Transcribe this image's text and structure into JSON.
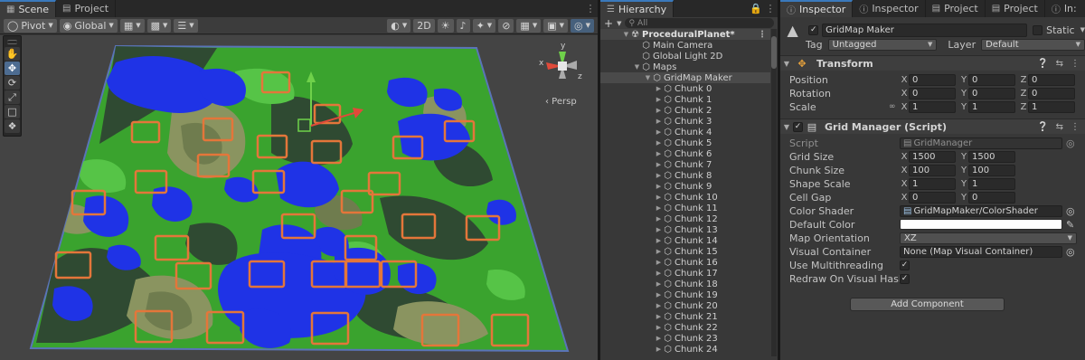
{
  "scene_panel": {
    "tabs": [
      {
        "label": "Scene",
        "icon": "grid-icon",
        "active": true
      },
      {
        "label": "Project",
        "icon": "folder-icon",
        "active": false
      }
    ],
    "toolbar": {
      "pivot_label": "Pivot",
      "global_label": "Global",
      "mode_2d_label": "2D"
    },
    "persp_label": "‹ Persp",
    "gizmo_axes": {
      "x": "x",
      "y": "y",
      "z": "z"
    },
    "colors": {
      "land_light": "#3aa32e",
      "land_dark": "#2f4a32",
      "land_sand": "#8a9460",
      "water": "#1f33e6",
      "chunk_outline": "#e4763a",
      "grid_border": "#5a74b8"
    }
  },
  "hierarchy": {
    "tab_label": "Hierarchy",
    "search_placeholder": "All",
    "scene_name": "ProceduralPlanet*",
    "items": [
      {
        "label": "Main Camera",
        "depth": 1,
        "fold": ""
      },
      {
        "label": "Global Light 2D",
        "depth": 1,
        "fold": ""
      },
      {
        "label": "Maps",
        "depth": 1,
        "fold": "▼"
      },
      {
        "label": "GridMap Maker",
        "depth": 2,
        "fold": "▼",
        "selected": true
      },
      {
        "label": "Chunk 0",
        "depth": 3,
        "fold": "▶"
      },
      {
        "label": "Chunk 1",
        "depth": 3,
        "fold": "▶"
      },
      {
        "label": "Chunk 2",
        "depth": 3,
        "fold": "▶"
      },
      {
        "label": "Chunk 3",
        "depth": 3,
        "fold": "▶"
      },
      {
        "label": "Chunk 4",
        "depth": 3,
        "fold": "▶"
      },
      {
        "label": "Chunk 5",
        "depth": 3,
        "fold": "▶"
      },
      {
        "label": "Chunk 6",
        "depth": 3,
        "fold": "▶"
      },
      {
        "label": "Chunk 7",
        "depth": 3,
        "fold": "▶"
      },
      {
        "label": "Chunk 8",
        "depth": 3,
        "fold": "▶"
      },
      {
        "label": "Chunk 9",
        "depth": 3,
        "fold": "▶"
      },
      {
        "label": "Chunk 10",
        "depth": 3,
        "fold": "▶"
      },
      {
        "label": "Chunk 11",
        "depth": 3,
        "fold": "▶"
      },
      {
        "label": "Chunk 12",
        "depth": 3,
        "fold": "▶"
      },
      {
        "label": "Chunk 13",
        "depth": 3,
        "fold": "▶"
      },
      {
        "label": "Chunk 14",
        "depth": 3,
        "fold": "▶"
      },
      {
        "label": "Chunk 15",
        "depth": 3,
        "fold": "▶"
      },
      {
        "label": "Chunk 16",
        "depth": 3,
        "fold": "▶"
      },
      {
        "label": "Chunk 17",
        "depth": 3,
        "fold": "▶"
      },
      {
        "label": "Chunk 18",
        "depth": 3,
        "fold": "▶"
      },
      {
        "label": "Chunk 19",
        "depth": 3,
        "fold": "▶"
      },
      {
        "label": "Chunk 20",
        "depth": 3,
        "fold": "▶"
      },
      {
        "label": "Chunk 21",
        "depth": 3,
        "fold": "▶"
      },
      {
        "label": "Chunk 22",
        "depth": 3,
        "fold": "▶"
      },
      {
        "label": "Chunk 23",
        "depth": 3,
        "fold": "▶"
      },
      {
        "label": "Chunk 24",
        "depth": 3,
        "fold": "▶"
      }
    ]
  },
  "inspector": {
    "tabs": [
      {
        "label": "Inspector",
        "icon": "info-icon",
        "active": true
      },
      {
        "label": "Inspector",
        "icon": "info-icon",
        "active": false
      },
      {
        "label": "Project",
        "icon": "folder-icon",
        "active": false
      },
      {
        "label": "Project",
        "icon": "folder-icon",
        "active": false
      },
      {
        "label": "In:",
        "icon": "info-icon",
        "active": false
      }
    ],
    "object": {
      "name": "GridMap Maker",
      "static_label": "Static",
      "tag_label": "Tag",
      "tag_value": "Untagged",
      "layer_label": "Layer",
      "layer_value": "Default"
    },
    "transform": {
      "title": "Transform",
      "rows": [
        {
          "label": "Position",
          "x": "0",
          "y": "0",
          "z": "0"
        },
        {
          "label": "Rotation",
          "x": "0",
          "y": "0",
          "z": "0"
        },
        {
          "label": "Scale",
          "x": "1",
          "y": "1",
          "z": "1"
        }
      ]
    },
    "grid_manager": {
      "title": "Grid Manager (Script)",
      "script_label": "Script",
      "script_value": "GridManager",
      "vec_rows": [
        {
          "label": "Grid Size",
          "x": "1500",
          "y": "1500"
        },
        {
          "label": "Chunk Size",
          "x": "100",
          "y": "100"
        },
        {
          "label": "Shape Scale",
          "x": "1",
          "y": "1"
        },
        {
          "label": "Cell Gap",
          "x": "0",
          "y": "0"
        }
      ],
      "color_shader_label": "Color Shader",
      "color_shader_value": "GridMapMaker/ColorShader",
      "default_color_label": "Default Color",
      "default_color_value": "#ffffff",
      "map_orientation_label": "Map Orientation",
      "map_orientation_value": "XZ",
      "visual_container_label": "Visual Container",
      "visual_container_value": "None (Map Visual Container)",
      "use_multithreading_label": "Use Multithreading",
      "use_multithreading": true,
      "redraw_label": "Redraw On Visual Hash Cha",
      "redraw": true
    },
    "add_component_label": "Add Component"
  }
}
